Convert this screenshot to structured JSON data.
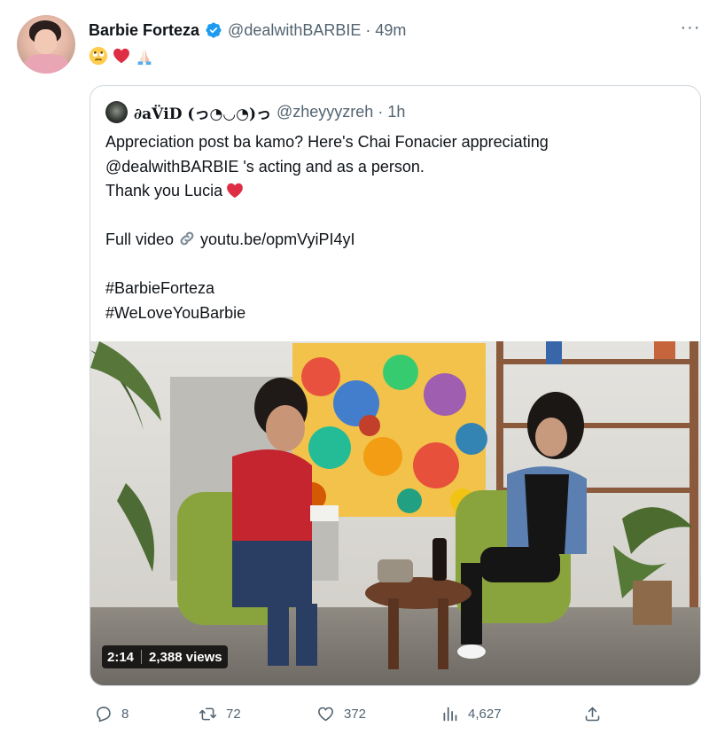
{
  "tweet": {
    "author_name": "Barbie Forteza",
    "handle": "@dealwithBARBIE",
    "separator": "·",
    "time": "49m",
    "more_label": "···",
    "emojis": [
      "rolling-eyes-emoji",
      "red-heart-emoji",
      "folded-hands-emoji"
    ]
  },
  "quoted": {
    "author_name": "∂aV̈iD (っ◔◡◔)っ",
    "handle": "@zheyyyzreh",
    "separator": "·",
    "time": "1h",
    "line1": "Appreciation post ba kamo? Here's Chai Fonacier appreciating",
    "line2": "@dealwithBARBIE 's acting and as a person.",
    "line3": "Thank you Lucia",
    "full_video_label": "Full video",
    "link_text": "youtu.be/opmVyiPI4yI",
    "hashtag1": "#BarbieForteza",
    "hashtag2": "#WeLoveYouBarbie",
    "video": {
      "duration": "2:14",
      "views": "2,388 views"
    }
  },
  "actions": {
    "replies": "8",
    "retweets": "72",
    "likes": "372",
    "views": "4,627"
  },
  "colors": {
    "verified": "#1d9bf0",
    "secondary_text": "#536471",
    "border": "#cfd9de",
    "heart": "#e0245e"
  }
}
